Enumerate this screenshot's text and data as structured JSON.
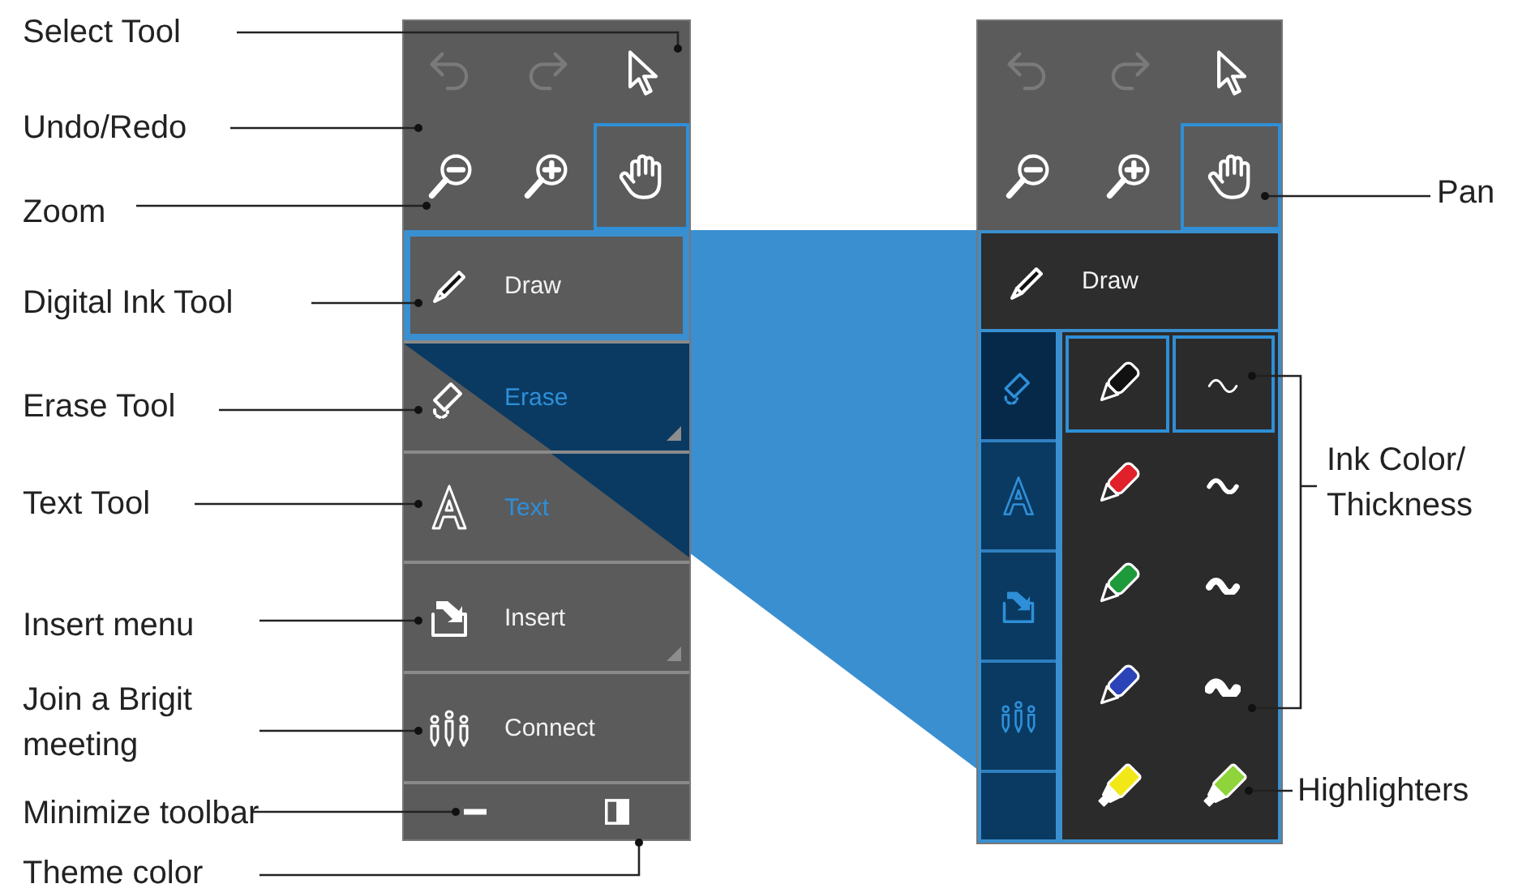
{
  "labels_left": [
    {
      "text": "Select Tool"
    },
    {
      "text": "Undo/Redo"
    },
    {
      "text": "Zoom"
    },
    {
      "text": "Digital Ink Tool"
    },
    {
      "text": "Erase Tool"
    },
    {
      "text": "Text Tool"
    },
    {
      "text": "Insert menu"
    },
    {
      "text": "Join a Brigit meeting"
    },
    {
      "text": "Minimize toolbar"
    },
    {
      "text": "Theme color"
    }
  ],
  "labels_right": [
    {
      "text": "Pan"
    },
    {
      "text": "Ink Color/ Thickness"
    },
    {
      "text": "Highlighters"
    }
  ],
  "toolbar_left": {
    "top_buttons": [
      {
        "kind": "undo",
        "disabled": true
      },
      {
        "kind": "redo",
        "disabled": true
      },
      {
        "kind": "select",
        "disabled": false
      }
    ],
    "view_buttons": [
      {
        "kind": "zoom_out",
        "selected": false
      },
      {
        "kind": "zoom_in",
        "selected": false
      },
      {
        "kind": "pan",
        "selected": true
      }
    ],
    "tools": [
      {
        "kind": "draw",
        "label": "Draw",
        "selected": true,
        "submenu": false
      },
      {
        "kind": "erase",
        "label": "Erase",
        "selected": false,
        "submenu": true
      },
      {
        "kind": "text",
        "label": "Text",
        "selected": false,
        "submenu": false
      },
      {
        "kind": "insert",
        "label": "Insert",
        "selected": false,
        "submenu": true
      },
      {
        "kind": "connect",
        "label": "Connect",
        "selected": false,
        "submenu": false
      }
    ],
    "footer": [
      {
        "kind": "minimize"
      },
      {
        "kind": "theme"
      }
    ]
  },
  "toolbar_right": {
    "top_buttons": [
      {
        "kind": "undo",
        "disabled": true
      },
      {
        "kind": "redo",
        "disabled": true
      },
      {
        "kind": "select",
        "disabled": false
      }
    ],
    "view_buttons": [
      {
        "kind": "zoom_out",
        "selected": false
      },
      {
        "kind": "zoom_in",
        "selected": false
      },
      {
        "kind": "pan",
        "selected": true
      }
    ],
    "tool": {
      "kind": "draw",
      "label": "Draw"
    },
    "side_tools": [
      {
        "kind": "erase",
        "selected": true
      },
      {
        "kind": "text",
        "selected": false
      },
      {
        "kind": "insert",
        "selected": false
      },
      {
        "kind": "connect",
        "selected": false
      }
    ],
    "palette": [
      {
        "kind": "pen",
        "color": "#111111",
        "selected": true
      },
      {
        "kind": "thickness",
        "selected": true
      },
      {
        "kind": "pen",
        "color": "#e0202a",
        "selected": false
      },
      {
        "kind": "thickness",
        "selected": false
      },
      {
        "kind": "pen",
        "color": "#1e9a3a",
        "selected": false
      },
      {
        "kind": "thickness",
        "selected": false
      },
      {
        "kind": "pen",
        "color": "#2a44b8",
        "selected": false
      },
      {
        "kind": "thickness",
        "selected": false
      },
      {
        "kind": "highlighter",
        "color": "#f2e818",
        "selected": false
      },
      {
        "kind": "highlighter",
        "color": "#8ed43a",
        "selected": false
      }
    ]
  }
}
